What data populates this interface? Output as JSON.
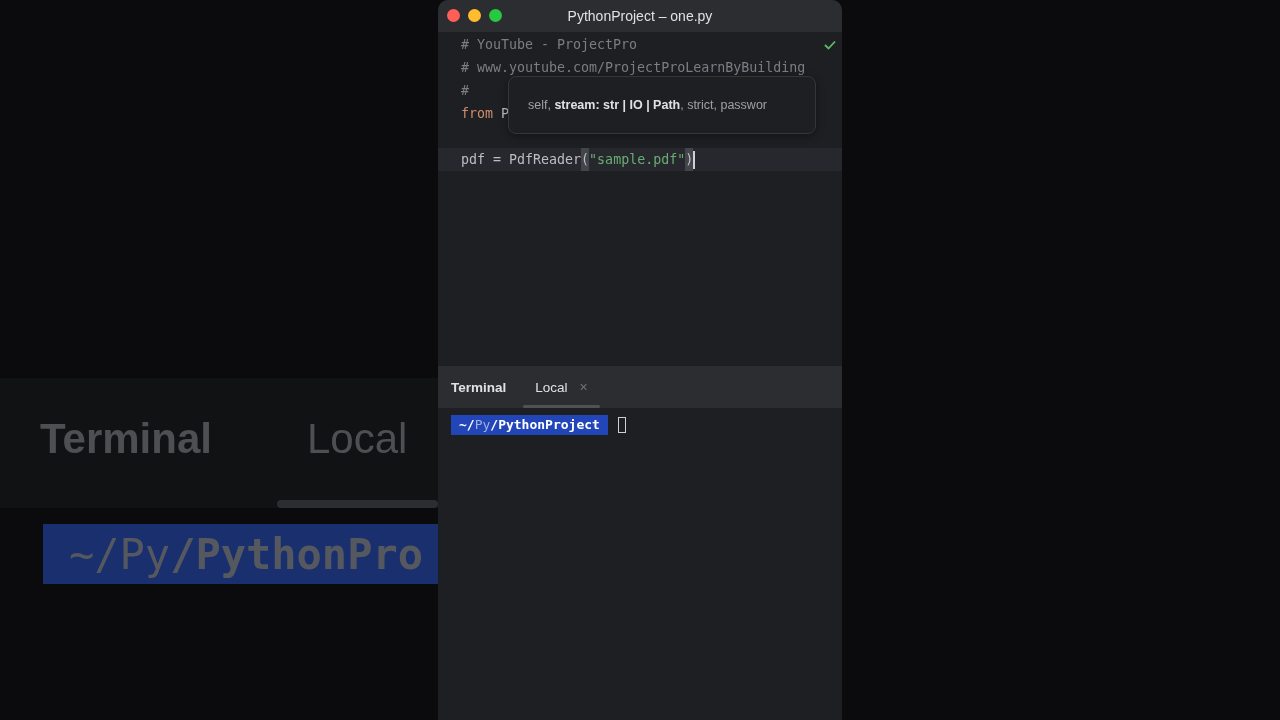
{
  "backdrop": {
    "terminal_label": "Terminal",
    "tab_label": "Local",
    "prompt": [
      {
        "text": "~/",
        "kind": "dim"
      },
      {
        "text": "Py",
        "kind": "dim"
      },
      {
        "text": "/PythonPro",
        "kind": "bold"
      }
    ]
  },
  "window": {
    "title": "PythonProject – one.py"
  },
  "editor": {
    "lines": [
      {
        "current": false,
        "tokens": [
          {
            "text": "# YouTube - ProjectPro",
            "kind": "comment"
          }
        ]
      },
      {
        "current": false,
        "tokens": [
          {
            "text": "# www.youtube.com/ProjectProLearnByBuilding",
            "kind": "comment"
          }
        ]
      },
      {
        "current": false,
        "tokens": [
          {
            "text": "#",
            "kind": "comment"
          }
        ]
      },
      {
        "current": false,
        "tokens": [
          {
            "text": "from",
            "kind": "keyword"
          },
          {
            "text": " P",
            "kind": "plain"
          }
        ]
      },
      {
        "current": false
      },
      {
        "current": true,
        "tokens": [
          {
            "text": "pdf = PdfReader",
            "kind": "plain"
          },
          {
            "text": "(",
            "kind": "bracket"
          },
          {
            "text": "\"sample.pdf\"",
            "kind": "string"
          },
          {
            "text": ")",
            "kind": "bracket"
          }
        ]
      }
    ],
    "tooltip": "self, **stream: str | IO | Path**, strict, passwor"
  },
  "terminal": {
    "label": "Terminal",
    "tabs": [
      {
        "label": "Local",
        "selected": true,
        "close": "×"
      }
    ],
    "prompt": [
      {
        "text": "~/",
        "kind": "bold"
      },
      {
        "text": "Py",
        "kind": "dim"
      },
      {
        "text": "/PythonProject",
        "kind": "bold"
      }
    ]
  }
}
